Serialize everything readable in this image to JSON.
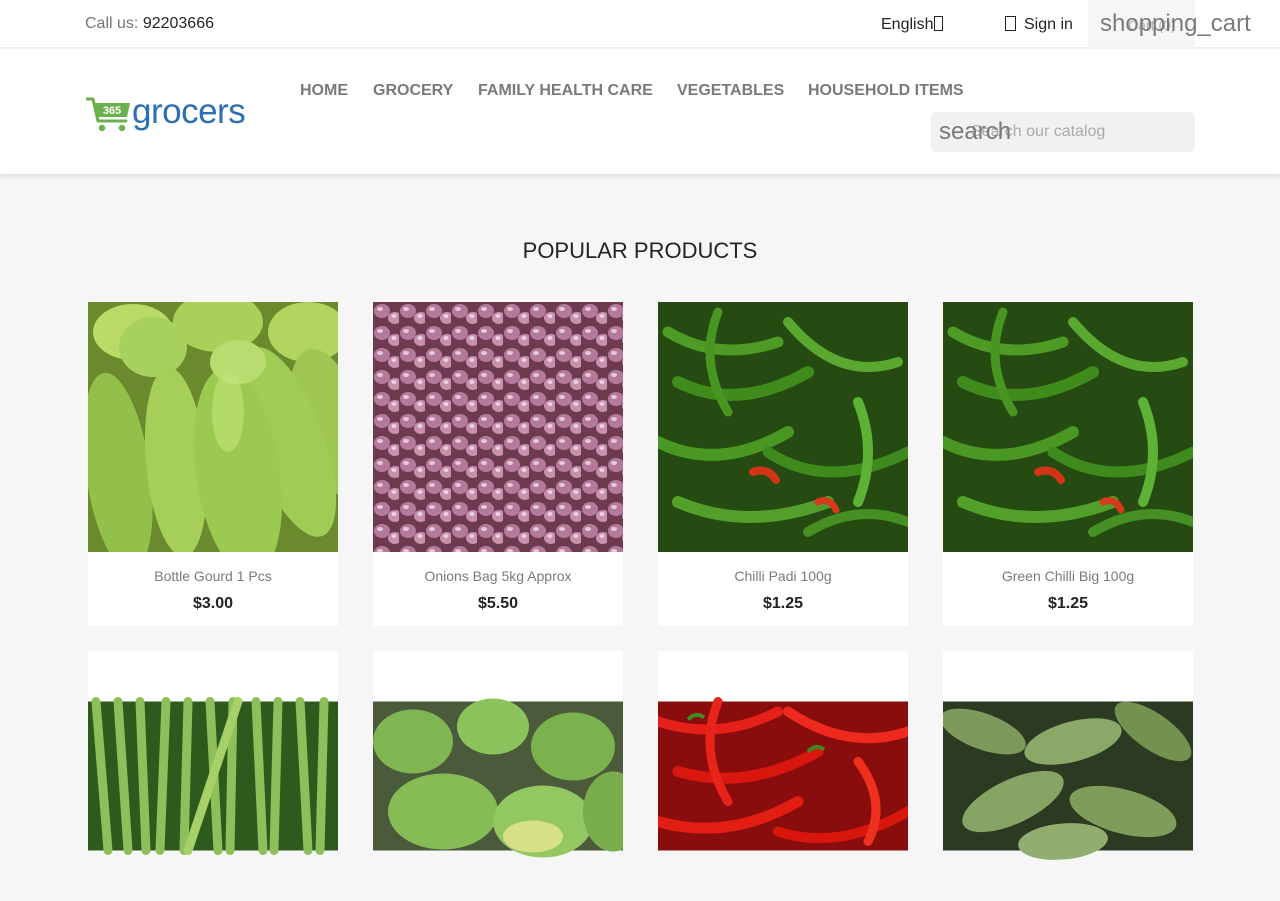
{
  "topbar": {
    "call_label": "Call us:",
    "phone": "92203666",
    "language": "English",
    "signin": "Sign in",
    "cart_icon_text": "shopping_cart",
    "cart_label": "Cart (0)"
  },
  "header": {
    "logo_badge": "365",
    "logo_text": "grocers",
    "nav": [
      "HOME",
      "GROCERY",
      "FAMILY HEALTH CARE",
      "VEGETABLES",
      "HOUSEHOLD ITEMS"
    ],
    "search_icon_text": "search",
    "search_placeholder": "Search our catalog"
  },
  "main": {
    "title": "POPULAR PRODUCTS",
    "products": [
      {
        "name": "Bottle Gourd 1 Pcs",
        "price": "$3.00",
        "image": "bottle-gourd"
      },
      {
        "name": "Onions Bag 5kg Approx",
        "price": "$5.50",
        "image": "onions"
      },
      {
        "name": "Chilli Padi 100g",
        "price": "$1.25",
        "image": "green-chilli"
      },
      {
        "name": "Green Chilli Big 100g",
        "price": "$1.25",
        "image": "green-chilli"
      },
      {
        "name": "",
        "price": "",
        "image": "long-beans"
      },
      {
        "name": "",
        "price": "",
        "image": "mangoes"
      },
      {
        "name": "",
        "price": "",
        "image": "red-chilli"
      },
      {
        "name": "",
        "price": "",
        "image": "broad-beans"
      }
    ]
  },
  "colors": {
    "brand_blue": "#2c6fb3",
    "brand_green": "#6ab04c",
    "nav_gray": "#7a7a7a",
    "background": "#f6f6f6"
  }
}
